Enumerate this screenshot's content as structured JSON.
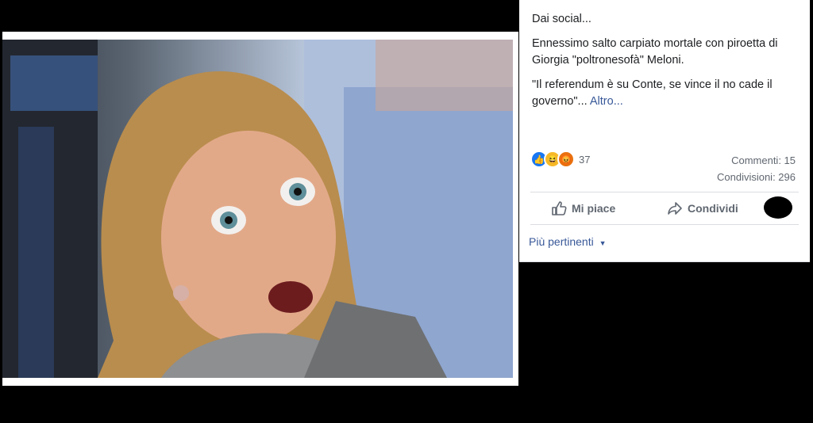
{
  "post": {
    "line1": "Dai social...",
    "line2": "Ennessimo salto carpiato mortale con piroetta di Giorgia \"poltronesofà\" Meloni.",
    "line3": "\"Il referendum è su Conte, se vince il no cade il governo\"...",
    "more_link": "Altro..."
  },
  "reactions": {
    "icons": [
      "like-icon",
      "haha-icon",
      "angry-icon"
    ],
    "count": "37"
  },
  "stats": {
    "comments": "Commenti: 15",
    "shares": "Condivisioni: 296"
  },
  "actions": {
    "like_label": "Mi piace",
    "share_label": "Condividi"
  },
  "sort": {
    "label": "Più pertinenti"
  },
  "colors": {
    "link": "#385898",
    "like_blue": "#1877f2",
    "text": "#1c1e21",
    "muted": "#606770"
  }
}
